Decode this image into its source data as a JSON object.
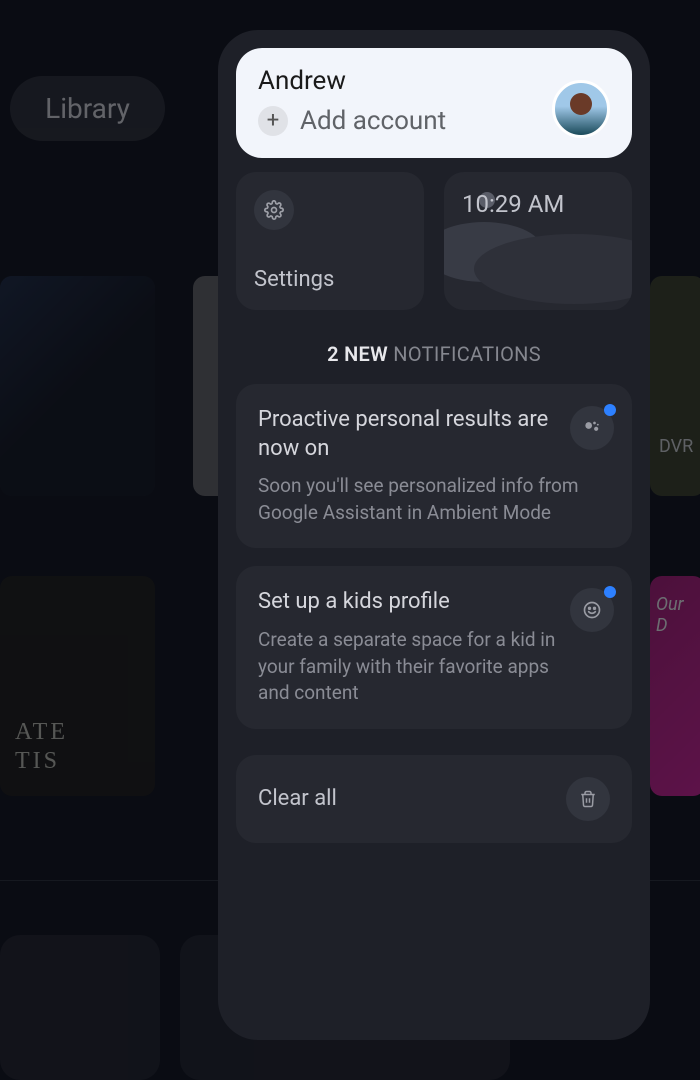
{
  "background": {
    "library_tab": "Library",
    "dvr_label": "DVR",
    "card4_text_line1": "ATE",
    "card4_text_line2": "TIS",
    "card5_text_line1": "Our",
    "card5_text_line2": "D"
  },
  "panel": {
    "account": {
      "name": "Andrew",
      "add_account_label": "Add account"
    },
    "tiles": {
      "settings_label": "Settings",
      "time": "10:29 AM"
    },
    "notifications": {
      "count_prefix": "2 NEW",
      "count_suffix": "NOTIFICATIONS",
      "items": [
        {
          "title": "Proactive personal results are now on",
          "body": "Soon you'll see personalized info from Google Assistant in Ambient Mode",
          "icon": "assistant-icon"
        },
        {
          "title": "Set up a kids profile",
          "body": "Create a separate space for a kid in your family with their favorite apps and content",
          "icon": "smiley-icon"
        }
      ],
      "clear_all_label": "Clear all"
    }
  }
}
